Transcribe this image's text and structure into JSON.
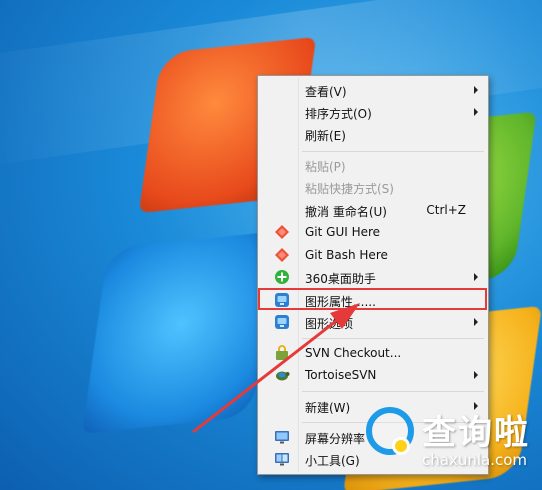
{
  "menu": {
    "items": [
      {
        "label": "查看(V)",
        "submenu": true
      },
      {
        "label": "排序方式(O)",
        "submenu": true
      },
      {
        "label": "刷新(E)"
      },
      {
        "label": "粘贴(P)",
        "disabled": true
      },
      {
        "label": "粘贴快捷方式(S)",
        "disabled": true
      },
      {
        "label": "撤消 重命名(U)",
        "shortcut": "Ctrl+Z"
      },
      {
        "label": "Git GUI Here",
        "icon": "git-icon"
      },
      {
        "label": "Git Bash Here",
        "icon": "git-icon"
      },
      {
        "label": "360桌面助手",
        "icon": "360-desktop-helper-icon",
        "submenu": true
      },
      {
        "label": "图形属性......",
        "icon": "graphics-properties-icon"
      },
      {
        "label": "图形选项",
        "icon": "graphics-options-icon",
        "submenu": true
      },
      {
        "label": "SVN Checkout...",
        "icon": "svn-checkout-icon"
      },
      {
        "label": "TortoiseSVN",
        "icon": "tortoisesvn-icon",
        "submenu": true
      },
      {
        "label": "新建(W)",
        "submenu": true
      },
      {
        "label": "屏幕分辨率",
        "icon": "screen-resolution-icon"
      },
      {
        "label": "小工具(G)",
        "icon": "gadgets-icon"
      }
    ]
  },
  "watermark": {
    "title": "查询啦",
    "url": "chaxunla.com"
  },
  "colors": {
    "highlight": "#e63a3a",
    "menu_bg": "#f1f1f1",
    "brand_blue": "#1e9be8"
  }
}
